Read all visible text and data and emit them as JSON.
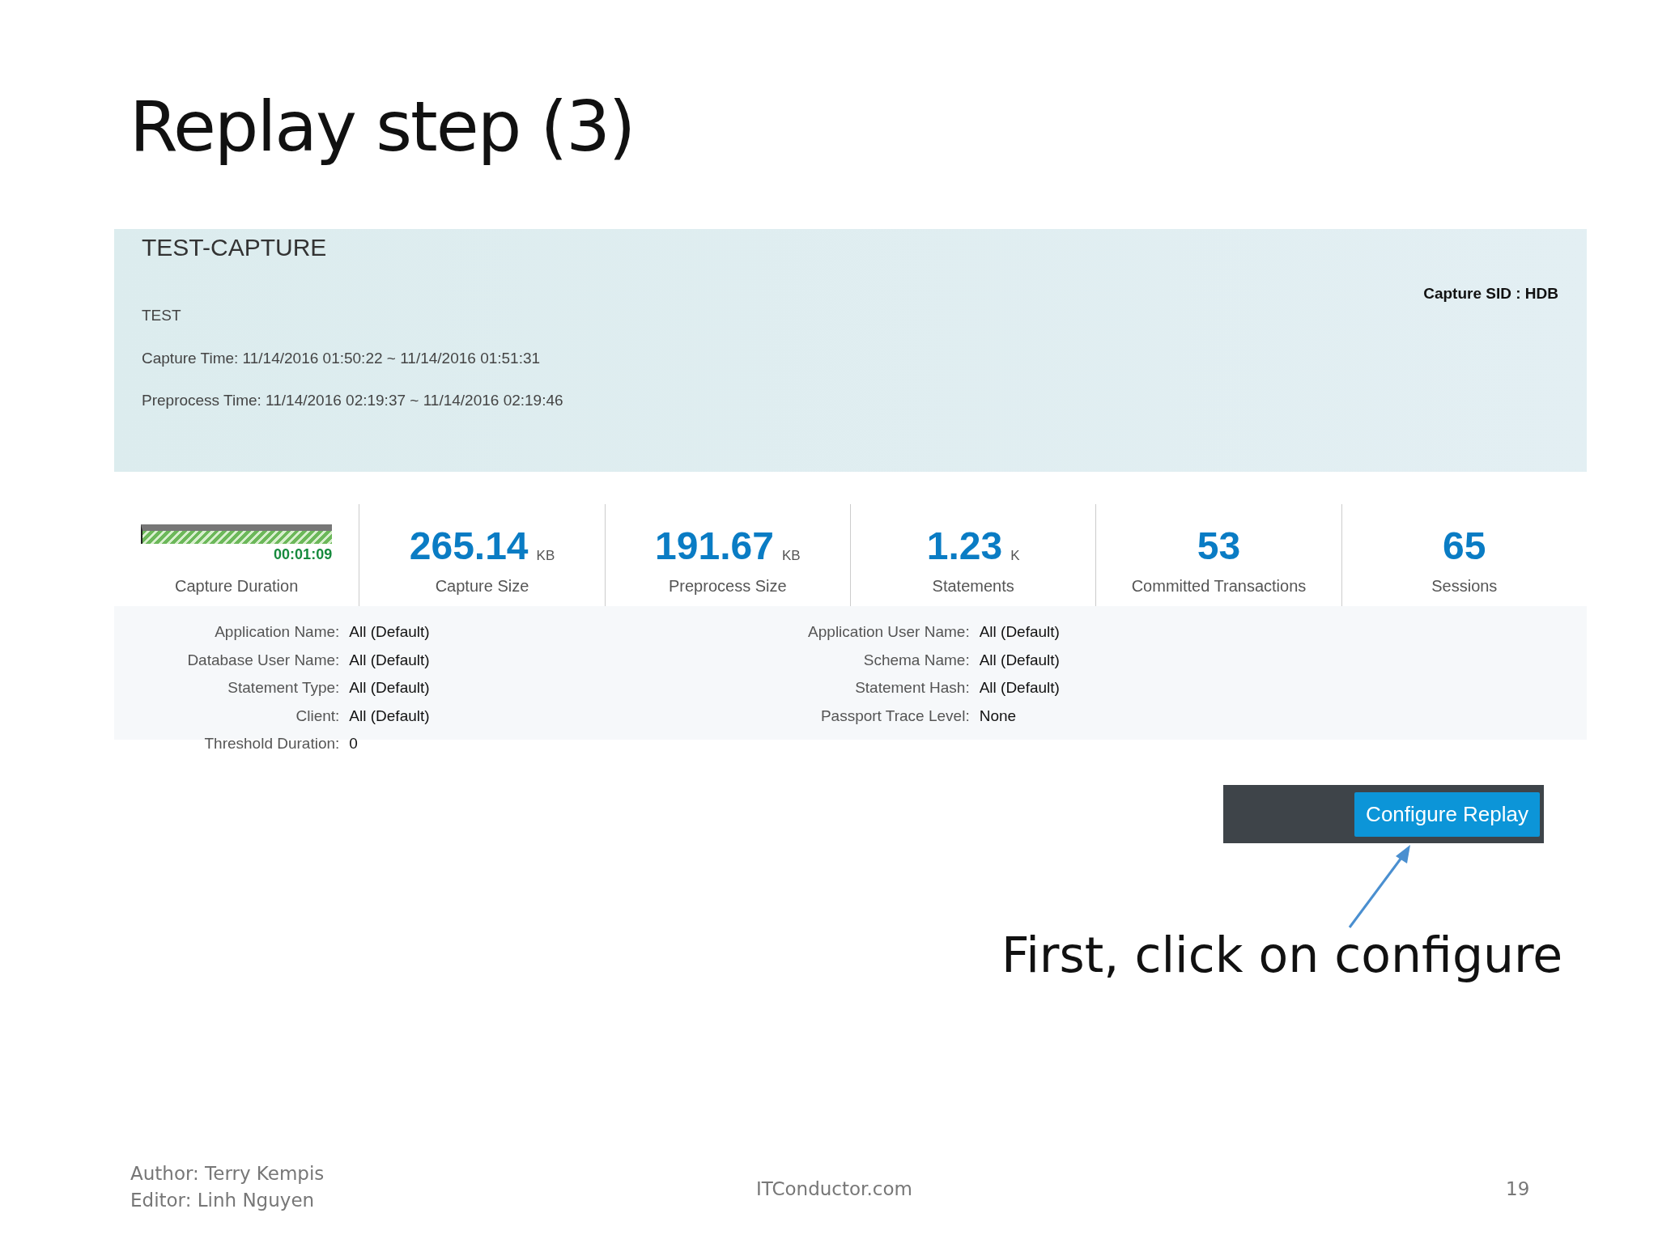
{
  "slide": {
    "title": "Replay step (3)"
  },
  "capture": {
    "name": "TEST-CAPTURE",
    "sid": "Capture SID : HDB",
    "description": "TEST",
    "capture_time": "Capture Time: 11/14/2016 01:50:22 ~ 11/14/2016 01:51:31",
    "preprocess_time": "Preprocess Time: 11/14/2016 02:19:37 ~ 11/14/2016 02:19:46"
  },
  "duration": {
    "level": 1.0,
    "value": "00:01:09",
    "label": "Capture Duration"
  },
  "stats": [
    {
      "value": "265.14",
      "unit": "KB",
      "label": "Capture Size"
    },
    {
      "value": "191.67",
      "unit": "KB",
      "label": "Preprocess Size"
    },
    {
      "value": "1.23",
      "unit": "K",
      "label": "Statements"
    },
    {
      "value": "53",
      "label": "Committed Transactions"
    },
    {
      "value": "65",
      "label": "Sessions"
    }
  ],
  "filters_left": [
    {
      "label": "Application Name:",
      "value": "All (Default)"
    },
    {
      "label": "Database User Name:",
      "value": "All (Default)"
    },
    {
      "label": "Statement Type:",
      "value": "All (Default)"
    },
    {
      "label": "Client:",
      "value": "All (Default)"
    },
    {
      "label": "Threshold Duration:",
      "value": "0"
    }
  ],
  "filters_right": [
    {
      "label": "Application User Name:",
      "value": "All (Default)"
    },
    {
      "label": "Schema Name:",
      "value": "All (Default)"
    },
    {
      "label": "Statement Hash:",
      "value": "All (Default)"
    },
    {
      "label": "Passport Trace Level:",
      "value": "None"
    }
  ],
  "configure_button": "Configure Replay",
  "annotation": "First, click on configure",
  "footer": {
    "author": "Author: Terry Kempis",
    "editor": "Editor: Linh Nguyen",
    "site": "ITConductor.com",
    "page": "19"
  }
}
